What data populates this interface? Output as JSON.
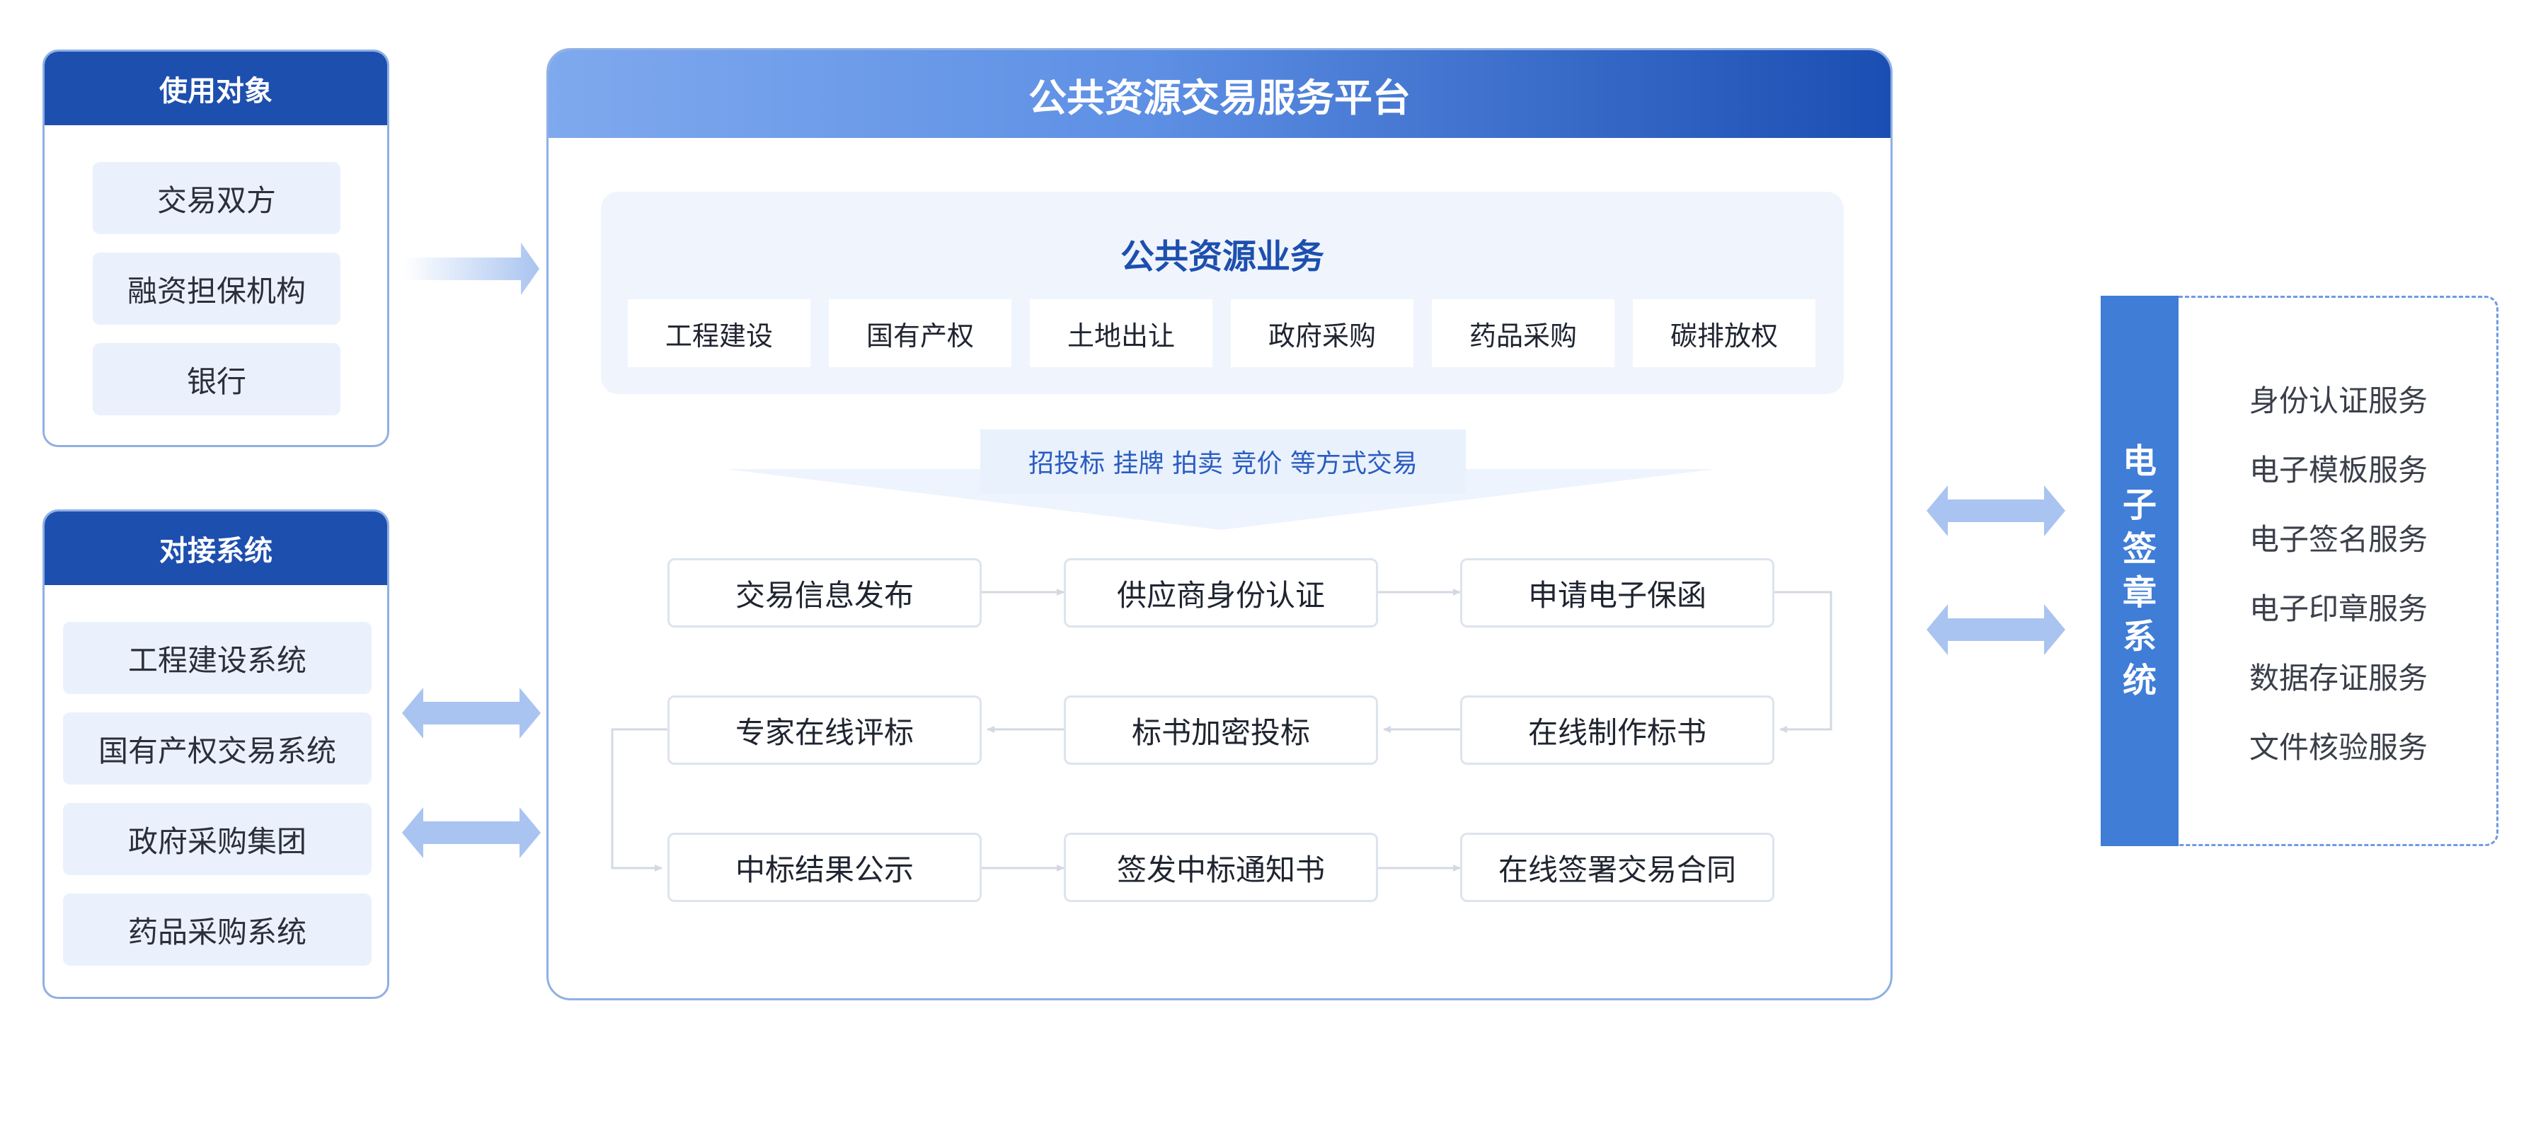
{
  "users": {
    "title": "使用对象",
    "items": [
      "交易双方",
      "融资担保机构",
      "银行"
    ]
  },
  "systems": {
    "title": "对接系统",
    "items": [
      "工程建设系统",
      "国有产权交易系统",
      "政府采购集团",
      "药品采购系统"
    ]
  },
  "platform": {
    "title": "公共资源交易服务平台",
    "business_title": "公共资源业务",
    "business": [
      "工程建设",
      "国有产权",
      "土地出让",
      "政府采购",
      "药品采购",
      "碳排放权"
    ],
    "method": "招投标 挂牌 拍卖 竞价 等方式交易",
    "steps": [
      [
        "交易信息发布",
        "供应商身份认证",
        "申请电子保函"
      ],
      [
        "专家在线评标",
        "标书加密投标",
        "在线制作标书"
      ],
      [
        "中标结果公示",
        "签发中标通知书",
        "在线签署交易合同"
      ]
    ]
  },
  "signature": {
    "title_chars": [
      "电",
      "子",
      "签",
      "章",
      "系",
      "统"
    ],
    "services": [
      "身份认证服务",
      "电子模板服务",
      "电子签名服务",
      "电子印章服务",
      "数据存证服务",
      "文件核验服务"
    ]
  },
  "colors": {
    "primary": "#1d4fae",
    "accent": "#3f7dd7",
    "arrow": "#a9c4f0",
    "border": "#8fb0e4"
  }
}
